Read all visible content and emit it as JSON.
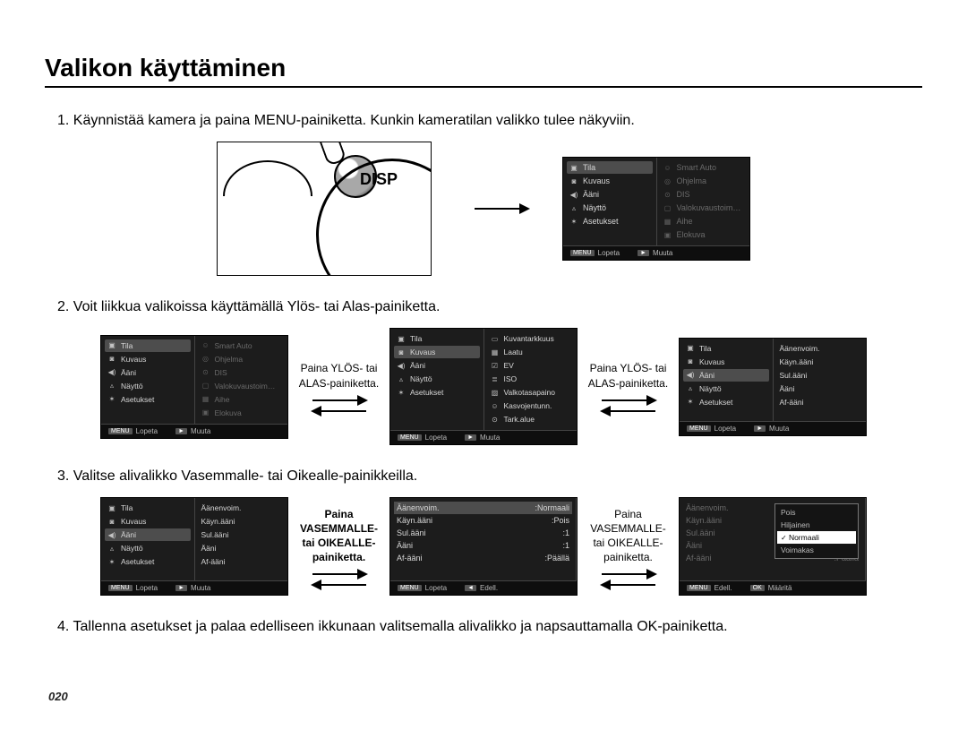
{
  "title": "Valikon käyttäminen",
  "page_number": "020",
  "steps": {
    "s1": "1. Käynnistää kamera ja paina MENU-painiketta.  Kunkin kameratilan valikko tulee näkyviin.",
    "s2": "2. Voit liikkua valikoissa käyttämällä Ylös- tai Alas-painiketta.",
    "s3": "3. Valitse alivalikko Vasemmalle- tai Oikealle-painikkeilla.",
    "s4": "4. Tallenna asetukset ja palaa edelliseen ikkunaan valitsemalla alivalikko ja napsauttamalla OK-painiketta."
  },
  "camera_dial": "DISP",
  "labels": {
    "up_down": "Paina YLÖS- tai ALAS-painiketta.",
    "left_right_bold": "Paina VASEMMALLE- tai OIKEALLE-painiketta.",
    "left_right": "Paina VASEMMALLE- tai OIKEALLE-painiketta."
  },
  "lcd_left_menu": [
    {
      "icon": "▣",
      "text": "Tila"
    },
    {
      "icon": "◙",
      "text": "Kuvaus"
    },
    {
      "icon": "◀)",
      "text": "Ääni"
    },
    {
      "icon": "▵",
      "text": "Näyttö"
    },
    {
      "icon": "✶",
      "text": "Asetukset"
    }
  ],
  "panel1_right_dim": [
    {
      "icon": "☺",
      "text": "Smart Auto"
    },
    {
      "icon": "◎",
      "text": "Ohjelma"
    },
    {
      "icon": "⊙",
      "text": "DIS"
    },
    {
      "icon": "▢",
      "text": "Valokuvaustoim…"
    },
    {
      "icon": "▦",
      "text": "Aihe"
    },
    {
      "icon": "▣",
      "text": "Elokuva"
    }
  ],
  "panel2b_right": [
    {
      "icon": "▭",
      "text": "Kuvantarkkuus"
    },
    {
      "icon": "▦",
      "text": "Laatu"
    },
    {
      "icon": "☑",
      "text": "EV"
    },
    {
      "icon": "≣",
      "text": "ISO"
    },
    {
      "icon": "▨",
      "text": "Valkotasapaino"
    },
    {
      "icon": "☺",
      "text": "Kasvojentunn."
    },
    {
      "icon": "⊙",
      "text": "Tark.alue"
    }
  ],
  "panel2c_right": [
    {
      "text": "Äänenvoim."
    },
    {
      "text": "Käyn.ääni"
    },
    {
      "text": "Sul.ääni"
    },
    {
      "text": "Ääni"
    },
    {
      "text": "Af-ääni"
    }
  ],
  "panel3b_right": [
    {
      "k": "Äänenvoim.",
      "v": ":Normaali"
    },
    {
      "k": "Käyn.ääni",
      "v": ":Pois"
    },
    {
      "k": "Sul.ääni",
      "v": ":1"
    },
    {
      "k": "Ääni",
      "v": ":1"
    },
    {
      "k": "Af-ääni",
      "v": ":Päällä"
    }
  ],
  "panel3c_right_dim": [
    {
      "k": "Äänenvoim."
    },
    {
      "k": "Käyn.ääni"
    },
    {
      "k": "Sul.ääni"
    },
    {
      "k": "Ääni"
    },
    {
      "k": "Af-ääni",
      "v": ":Päällä"
    }
  ],
  "panel3c_popup": [
    "Pois",
    "Hiljainen",
    "Normaali",
    "Voimakas"
  ],
  "foot": {
    "lopeta": "Lopeta",
    "muuta": "Muuta",
    "edell": "Edell.",
    "maarita": "Määritä",
    "menu_badge": "MENU",
    "play_badge": "►",
    "left_badge": "◄",
    "ok_badge": "OK"
  }
}
